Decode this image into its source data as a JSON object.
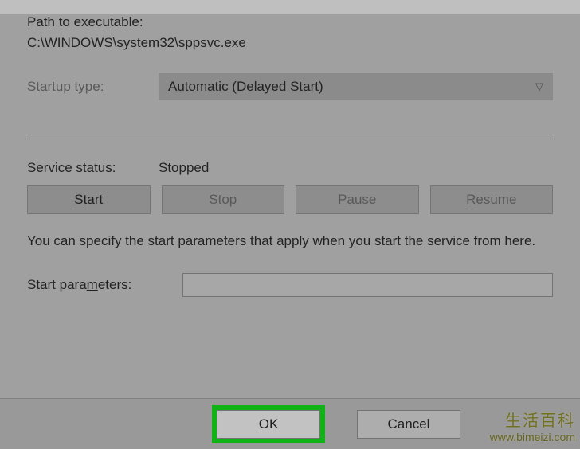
{
  "path": {
    "label": "Path to executable:",
    "value": "C:\\WINDOWS\\system32\\sppsvc.exe"
  },
  "startup": {
    "label": "Startup type:",
    "underline_char": "e",
    "selected": "Automatic (Delayed Start)"
  },
  "status": {
    "label": "Service status:",
    "value": "Stopped"
  },
  "buttons": {
    "start": "Start",
    "stop": "Stop",
    "pause": "Pause",
    "resume": "Resume"
  },
  "help": "You can specify the start parameters that apply when you start the service from here.",
  "params": {
    "label": "Start parameters:",
    "underline_char": "m",
    "value": ""
  },
  "dialog": {
    "ok": "OK",
    "cancel": "Cancel"
  },
  "watermark": {
    "line1": "生活百科",
    "line2": "www.bimeizi.com"
  }
}
